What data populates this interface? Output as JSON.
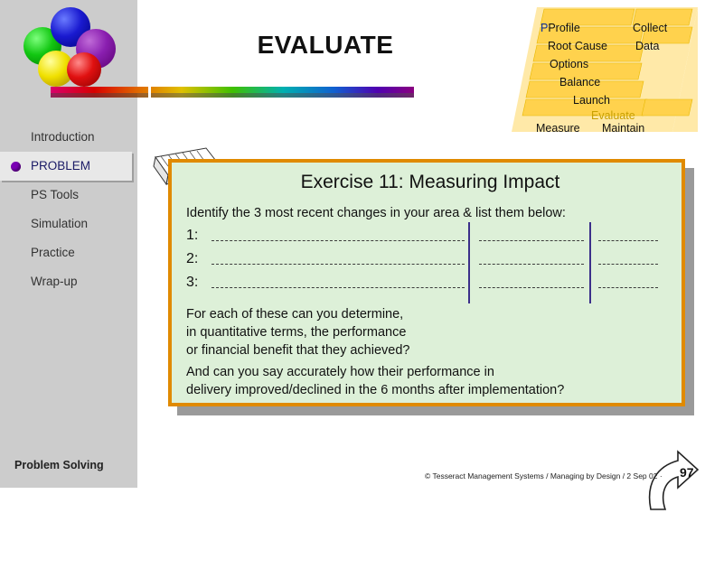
{
  "slide": {
    "title": "EVALUATE",
    "page_number": "97",
    "copyright": "© Tesseract Management Systems / Managing by Design / 2 Sep 02  ·"
  },
  "sidebar": {
    "footer_label": "Problem Solving",
    "items": [
      {
        "label": "Introduction",
        "current": false
      },
      {
        "label": "PROBLEM",
        "current": true
      },
      {
        "label": "PS Tools",
        "current": false
      },
      {
        "label": "Simulation",
        "current": false
      },
      {
        "label": "Practice",
        "current": false
      },
      {
        "label": "Wrap-up",
        "current": false
      }
    ]
  },
  "process_diagram": {
    "steps": [
      {
        "label": "Profile",
        "highlight": false
      },
      {
        "label": "Collect",
        "highlight": false
      },
      {
        "label": "Root Cause",
        "highlight": false
      },
      {
        "label": "Data",
        "highlight": false
      },
      {
        "label": "Options",
        "highlight": false
      },
      {
        "label": "Balance",
        "highlight": false
      },
      {
        "label": "Launch",
        "highlight": false
      },
      {
        "label": "Evaluate",
        "highlight": true
      },
      {
        "label": "Measure",
        "highlight": false
      },
      {
        "label": "Maintain",
        "highlight": false
      }
    ]
  },
  "panel": {
    "title": "Exercise 11: Measuring Impact",
    "instruction": "Identify the 3 most recent changes in your area & list them below:",
    "numbered_items": [
      "1:",
      "2:",
      "3:"
    ],
    "paragraph1_line1": "For each of these can you determine,",
    "paragraph1_line2": "in quantitative terms, the performance",
    "paragraph1_line3": "or financial benefit that they achieved?",
    "paragraph2_line1": "And can you say accurately how their performance in",
    "paragraph2_line2": "delivery improved/declined in the 6 months after implementation?"
  },
  "colors": {
    "panel_bg": "#ddf0d8",
    "panel_border": "#e08a00",
    "sidebar_bg": "#cccccc",
    "highlight": "#c8a000",
    "process_fill": "#ffe082"
  }
}
